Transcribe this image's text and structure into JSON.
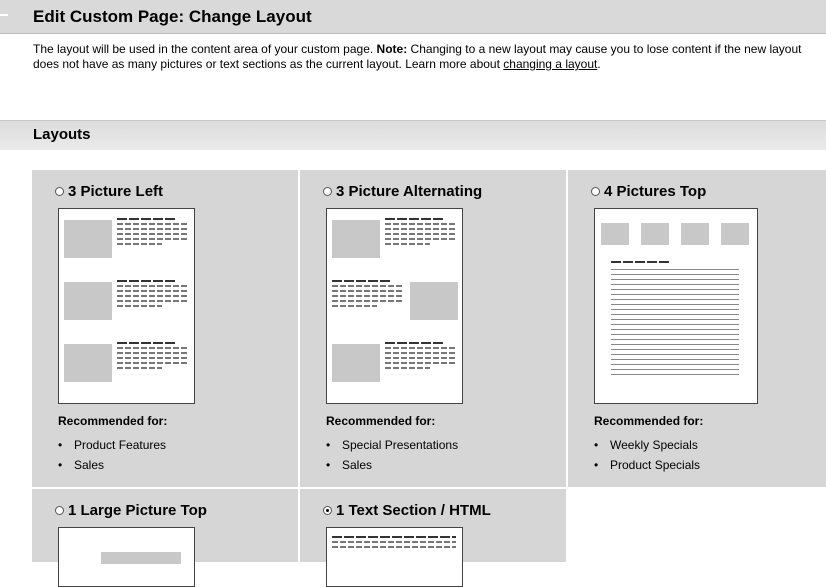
{
  "header": {
    "title": "Edit Custom Page: Change Layout"
  },
  "intro": {
    "text_before": "The layout will be used in the content area of your custom page. ",
    "note_label": "Note:",
    "text_after": " Changing to a new layout may cause you to lose content if the new layout does not have as many pictures or text sections as the current layout. Learn more about ",
    "link": "changing a layout",
    "end": "."
  },
  "layouts_section": {
    "title": "Layouts"
  },
  "layouts": [
    {
      "label": "3 Picture Left",
      "selected": false,
      "recommended_label": "Recommended for:",
      "recommended": [
        "Product Features",
        "Sales"
      ]
    },
    {
      "label": "3 Picture Alternating",
      "selected": false,
      "recommended_label": "Recommended for:",
      "recommended": [
        "Special Presentations",
        "Sales"
      ]
    },
    {
      "label": "4 Pictures Top",
      "selected": false,
      "recommended_label": "Recommended for:",
      "recommended": [
        "Weekly Specials",
        "Product Specials"
      ]
    },
    {
      "label": "1 Large Picture Top",
      "selected": false
    },
    {
      "label": "1 Text Section / HTML",
      "selected": true
    }
  ]
}
